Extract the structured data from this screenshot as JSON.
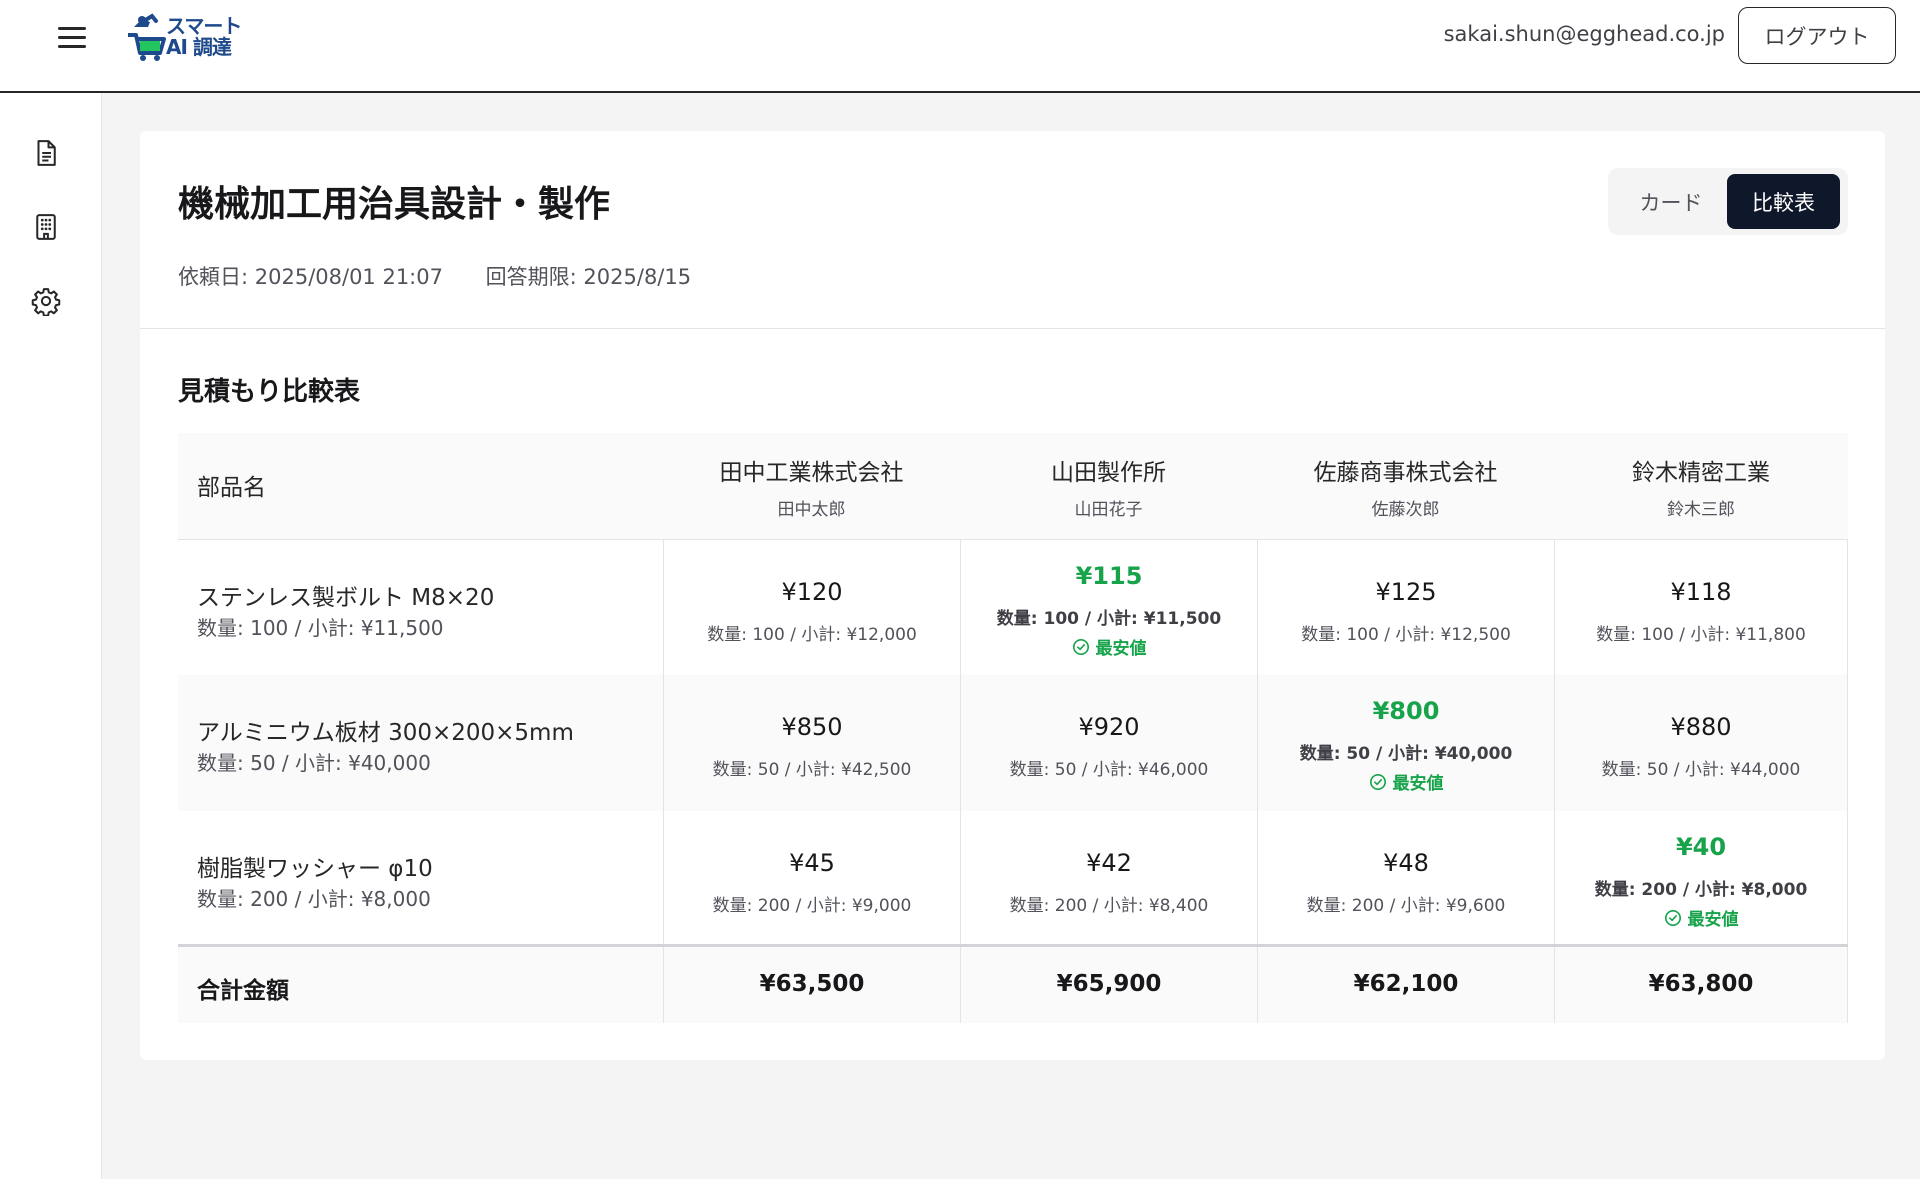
{
  "header": {
    "logo_line1": "スマート",
    "logo_line2": "AI 調達",
    "user_email": "sakai.shun@egghead.co.jp",
    "logout_label": "ログアウト"
  },
  "sidebar": {
    "items": [
      {
        "icon": "document-icon"
      },
      {
        "icon": "building-icon"
      },
      {
        "icon": "gear-icon"
      }
    ]
  },
  "page": {
    "title": "機械加工用治具設計・製作",
    "request_date": "依頼日: 2025/08/01 21:07",
    "deadline": "回答期限: 2025/8/15",
    "view_toggle": {
      "card_label": "カード",
      "compare_label": "比較表",
      "selected": "比較表"
    }
  },
  "comparison": {
    "section_title": "見積もり比較表",
    "part_header": "部品名",
    "vendors": [
      {
        "name": "田中工業株式会社",
        "contact": "田中太郎"
      },
      {
        "name": "山田製作所",
        "contact": "山田花子"
      },
      {
        "name": "佐藤商事株式会社",
        "contact": "佐藤次郎"
      },
      {
        "name": "鈴木精密工業",
        "contact": "鈴木三郎"
      }
    ],
    "rows": [
      {
        "part": "ステンレス製ボルト M8×20",
        "summary": "数量: 100 / 小計: ¥11,500",
        "quotes": [
          {
            "price": "¥120",
            "detail": "数量: 100 / 小計: ¥12,000"
          },
          {
            "price": "¥115",
            "detail": "数量: 100 / 小計: ¥11,500",
            "best": "最安値"
          },
          {
            "price": "¥125",
            "detail": "数量: 100 / 小計: ¥12,500"
          },
          {
            "price": "¥118",
            "detail": "数量: 100 / 小計: ¥11,800"
          }
        ]
      },
      {
        "part": "アルミニウム板材 300×200×5mm",
        "summary": "数量: 50 / 小計: ¥40,000",
        "quotes": [
          {
            "price": "¥850",
            "detail": "数量: 50 / 小計: ¥42,500"
          },
          {
            "price": "¥920",
            "detail": "数量: 50 / 小計: ¥46,000"
          },
          {
            "price": "¥800",
            "detail": "数量: 50 / 小計: ¥40,000",
            "best": "最安値"
          },
          {
            "price": "¥880",
            "detail": "数量: 50 / 小計: ¥44,000"
          }
        ]
      },
      {
        "part": "樹脂製ワッシャー φ10",
        "summary": "数量: 200 / 小計: ¥8,000",
        "quotes": [
          {
            "price": "¥45",
            "detail": "数量: 200 / 小計: ¥9,000"
          },
          {
            "price": "¥42",
            "detail": "数量: 200 / 小計: ¥8,400"
          },
          {
            "price": "¥48",
            "detail": "数量: 200 / 小計: ¥9,600"
          },
          {
            "price": "¥40",
            "detail": "数量: 200 / 小計: ¥8,000",
            "best": "最安値"
          }
        ]
      }
    ],
    "total": {
      "label": "合計金額",
      "values": [
        "¥63,500",
        "¥65,900",
        "¥62,100",
        "¥63,800"
      ]
    }
  },
  "colors": {
    "accent_dark": "#0f172a",
    "best_green": "#16a34a",
    "logo_blue": "#1e4a8c"
  }
}
